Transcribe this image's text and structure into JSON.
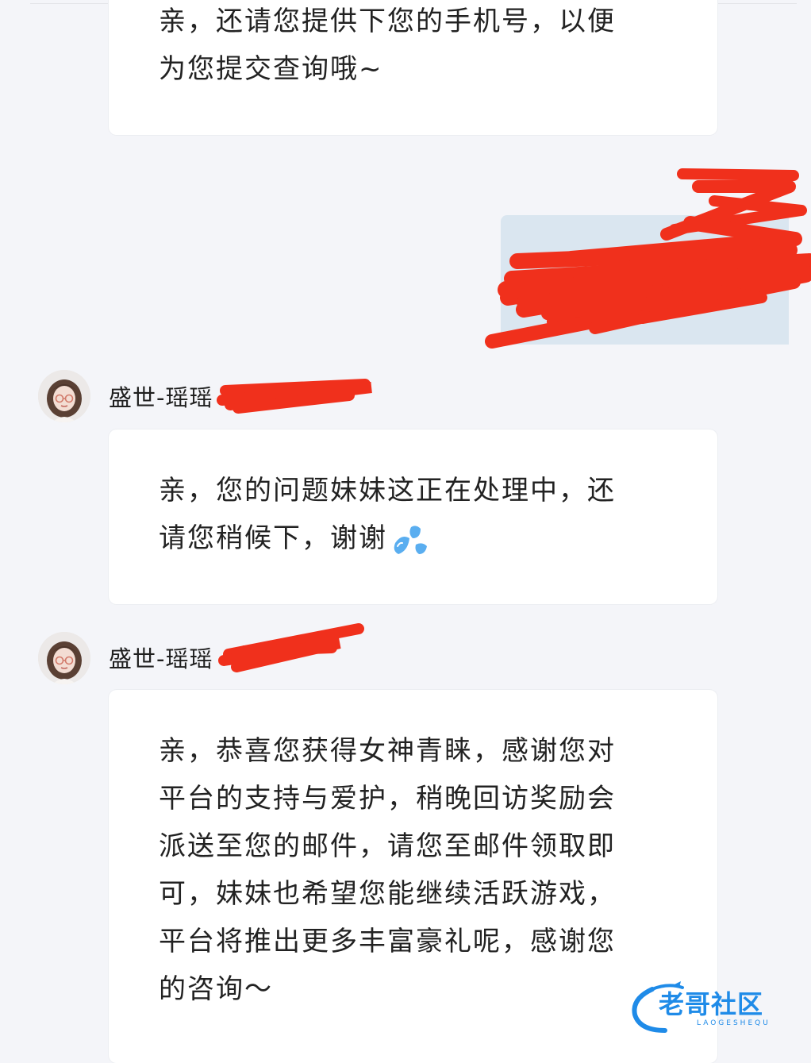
{
  "colors": {
    "page_background": "#f4f5f9",
    "bubble_background": "#ffffff",
    "sent_bubble_background": "#dae6f0",
    "redaction_red": "#f0301c",
    "watermark_blue": "#1f8be8"
  },
  "messages": [
    {
      "direction": "incoming",
      "lines": [
        "亲，还请您提供下您的手机号，以便",
        "为您提交查询哦~"
      ]
    },
    {
      "direction": "outgoing",
      "content": "redacted"
    },
    {
      "direction": "incoming",
      "sender": "盛世-瑶瑶",
      "avatar_icon": "avatar-girl-with-glasses",
      "lines": [
        "亲，您的问题妹妹这正在处理中，还",
        "请您稍候下，谢谢"
      ],
      "trailing_icon": "sweat-droplets-emoji"
    },
    {
      "direction": "incoming",
      "sender": "盛世-瑶瑶",
      "avatar_icon": "avatar-girl-with-glasses",
      "lines": [
        "亲，恭喜您获得女神青睐，感谢您对",
        "平台的支持与爱护，稍晚回访奖励会",
        "派送至您的邮件，请您至邮件领取即",
        "可，妹妹也希望您能继续活跃游戏，",
        "平台将推出更多丰富豪礼呢，感谢您",
        "的咨询～"
      ]
    }
  ],
  "watermark": {
    "title": "老哥社区",
    "subtitle": "LAOGESHEQU",
    "icon": "dragon-logo-icon"
  }
}
